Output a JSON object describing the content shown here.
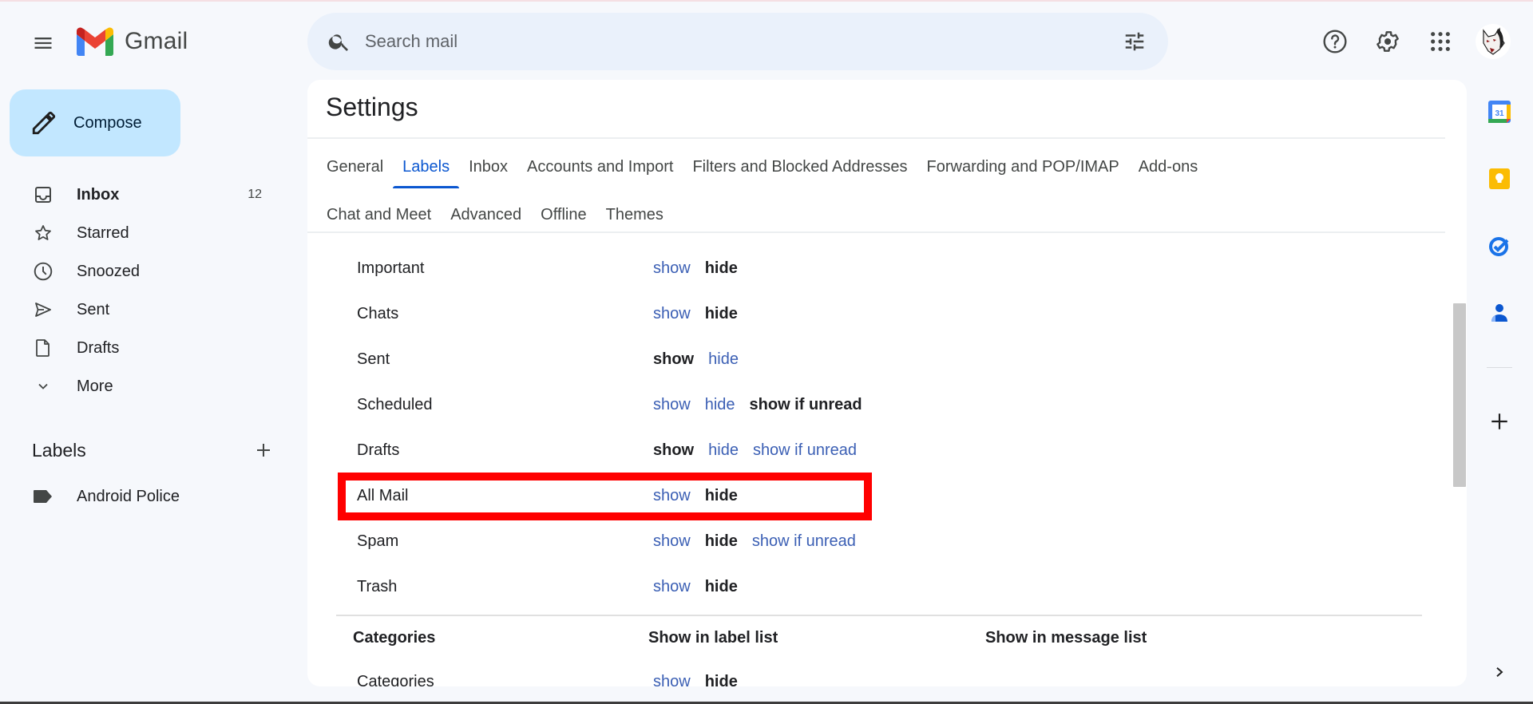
{
  "app": {
    "name": "Gmail"
  },
  "search": {
    "placeholder": "Search mail",
    "value": ""
  },
  "compose": {
    "label": "Compose"
  },
  "nav": {
    "items": [
      {
        "label": "Inbox",
        "count": "12",
        "icon": "inbox-icon",
        "bold": true
      },
      {
        "label": "Starred",
        "count": "",
        "icon": "star-icon"
      },
      {
        "label": "Snoozed",
        "count": "",
        "icon": "clock-icon"
      },
      {
        "label": "Sent",
        "count": "",
        "icon": "send-icon"
      },
      {
        "label": "Drafts",
        "count": "",
        "icon": "draft-icon"
      },
      {
        "label": "More",
        "count": "",
        "icon": "chevron-down-icon"
      }
    ]
  },
  "labels": {
    "title": "Labels",
    "items": [
      {
        "label": "Android Police",
        "icon": "label-icon"
      }
    ]
  },
  "settings": {
    "title": "Settings",
    "tabs_row1": [
      "General",
      "Labels",
      "Inbox",
      "Accounts and Import",
      "Filters and Blocked Addresses",
      "Forwarding and POP/IMAP",
      "Add-ons"
    ],
    "tabs_row2": [
      "Chat and Meet",
      "Advanced",
      "Offline",
      "Themes"
    ],
    "active_tab": "Labels",
    "system_labels": [
      {
        "name": "Important",
        "options": [
          {
            "text": "show",
            "selected": false
          },
          {
            "text": "hide",
            "selected": true
          }
        ]
      },
      {
        "name": "Chats",
        "options": [
          {
            "text": "show",
            "selected": false
          },
          {
            "text": "hide",
            "selected": true
          }
        ]
      },
      {
        "name": "Sent",
        "options": [
          {
            "text": "show",
            "selected": true
          },
          {
            "text": "hide",
            "selected": false
          }
        ]
      },
      {
        "name": "Scheduled",
        "options": [
          {
            "text": "show",
            "selected": false
          },
          {
            "text": "hide",
            "selected": false
          },
          {
            "text": "show if unread",
            "selected": true
          }
        ]
      },
      {
        "name": "Drafts",
        "options": [
          {
            "text": "show",
            "selected": true
          },
          {
            "text": "hide",
            "selected": false
          },
          {
            "text": "show if unread",
            "selected": false
          }
        ]
      },
      {
        "name": "All Mail",
        "options": [
          {
            "text": "show",
            "selected": false
          },
          {
            "text": "hide",
            "selected": true
          }
        ],
        "highlighted": true
      },
      {
        "name": "Spam",
        "options": [
          {
            "text": "show",
            "selected": false
          },
          {
            "text": "hide",
            "selected": true
          },
          {
            "text": "show if unread",
            "selected": false
          }
        ]
      },
      {
        "name": "Trash",
        "options": [
          {
            "text": "show",
            "selected": false
          },
          {
            "text": "hide",
            "selected": true
          }
        ]
      }
    ],
    "categories_header": {
      "col1": "Categories",
      "col2": "Show in label list",
      "col3": "Show in message list"
    },
    "categories": [
      {
        "name": "Categories",
        "options": [
          {
            "text": "show",
            "selected": false
          },
          {
            "text": "hide",
            "selected": true
          }
        ]
      }
    ]
  },
  "colors": {
    "accent": "#0b57d0",
    "link": "#3b5fb4",
    "compose_bg": "#c2e7ff",
    "search_bg": "#eaf1fb",
    "highlight": "#ff0000"
  }
}
